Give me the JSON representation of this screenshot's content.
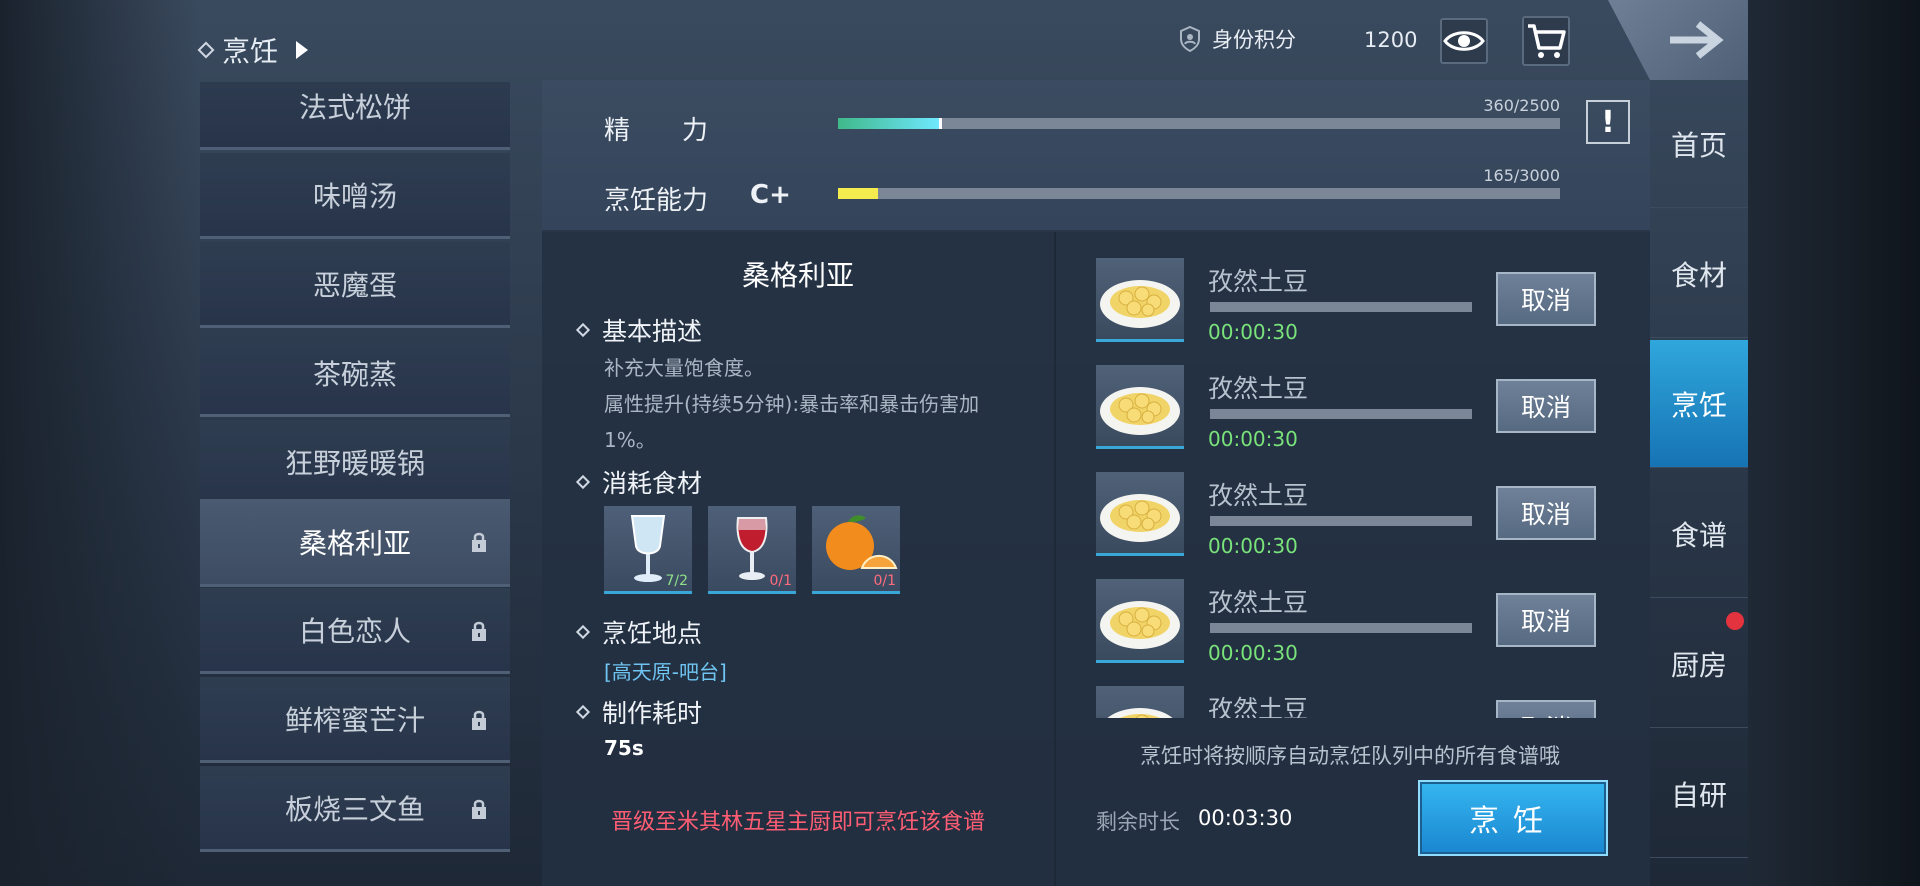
{
  "header": {
    "breadcrumb_label": "烹饪",
    "points_label": "身份积分",
    "points_value": "1200"
  },
  "recipes": [
    {
      "name": "法式松饼",
      "locked": false
    },
    {
      "name": "味噌汤",
      "locked": false
    },
    {
      "name": "恶魔蛋",
      "locked": false
    },
    {
      "name": "茶碗蒸",
      "locked": false
    },
    {
      "name": "狂野暖暖锅",
      "locked": false
    },
    {
      "name": "桑格利亚",
      "locked": true,
      "selected": true
    },
    {
      "name": "白色恋人",
      "locked": true
    },
    {
      "name": "鲜榨蜜芒汁",
      "locked": true
    },
    {
      "name": "板烧三文鱼",
      "locked": true
    }
  ],
  "stats": {
    "energy_label": "精　　力",
    "energy_value": "360/2500",
    "energy_fraction": 0.144,
    "cooking_label": "烹饪能力",
    "cooking_grade": "C+",
    "cooking_value": "165/3000",
    "cooking_fraction": 0.055,
    "warn_symbol": "!"
  },
  "detail": {
    "title": "桑格利亚",
    "basic_desc_head": "基本描述",
    "desc_line1": "补充大量饱食度。",
    "desc_line2": "属性提升(持续5分钟):暴击率和暴击伤害加",
    "desc_line3": "1%。",
    "ingredients_head": "消耗食材",
    "ingredients": [
      {
        "icon": "water-glass-icon",
        "count": "7/2",
        "count_color": "#8fe08a"
      },
      {
        "icon": "red-wine-icon",
        "count": "0/1",
        "count_color": "#ff6b7d"
      },
      {
        "icon": "orange-icon",
        "count": "0/1",
        "count_color": "#ff6b7d"
      }
    ],
    "location_head": "烹饪地点",
    "location": "[高天原-吧台]",
    "time_head": "制作耗时",
    "time": "75s",
    "unlock_hint": "晋级至米其林五星主厨即可烹饪该食谱"
  },
  "queue": {
    "items": [
      {
        "name": "孜然土豆",
        "time": "00:00:30",
        "cancel": "取消"
      },
      {
        "name": "孜然土豆",
        "time": "00:00:30",
        "cancel": "取消"
      },
      {
        "name": "孜然土豆",
        "time": "00:00:30",
        "cancel": "取消"
      },
      {
        "name": "孜然土豆",
        "time": "00:00:30",
        "cancel": "取消"
      },
      {
        "name": "孜然土豆",
        "time": "",
        "cancel": "取消"
      }
    ],
    "hint": "烹饪时将按顺序自动烹饪队列中的所有食谱哦",
    "remaining_label": "剩余时长",
    "remaining_value": "00:03:30",
    "cook_label": "烹饪"
  },
  "nav": [
    {
      "label": "首页"
    },
    {
      "label": "食材"
    },
    {
      "label": "烹饪",
      "active": true
    },
    {
      "label": "食谱"
    },
    {
      "label": "厨房",
      "badge": true
    },
    {
      "label": "自研"
    }
  ]
}
